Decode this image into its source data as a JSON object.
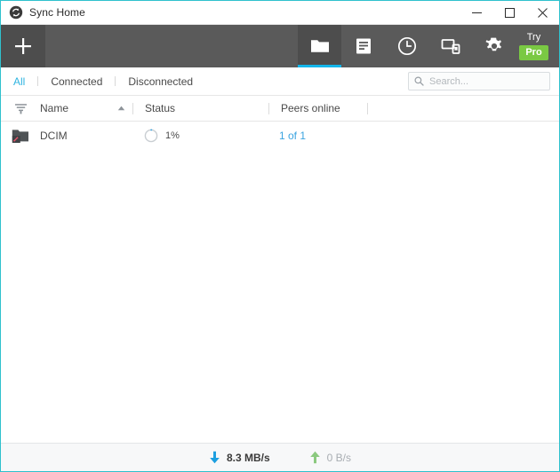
{
  "window": {
    "title": "Sync Home",
    "app_icon": "sync-circle-icon",
    "accent_border": "#2fc1cd",
    "controls": {
      "minimize": "minimize-icon",
      "maximize": "maximize-icon",
      "close": "close-icon"
    }
  },
  "toolbar": {
    "background": "#5a5a5a",
    "add_label": "+",
    "add_icon": "plus-icon",
    "active_underline": "#13b5ea",
    "tabs": [
      {
        "name": "folders",
        "icon": "folder-icon",
        "active": true
      },
      {
        "name": "transfers",
        "icon": "document-list-icon",
        "active": false
      },
      {
        "name": "history",
        "icon": "clock-icon",
        "active": false
      },
      {
        "name": "devices",
        "icon": "devices-icon",
        "active": false
      },
      {
        "name": "settings",
        "icon": "gear-icon",
        "active": false
      }
    ],
    "try_pro": {
      "try_label": "Try",
      "pro_label": "Pro",
      "badge_color": "#7ac943"
    }
  },
  "filters": {
    "items": [
      {
        "label": "All",
        "active": true
      },
      {
        "label": "Connected",
        "active": false
      },
      {
        "label": "Disconnected",
        "active": false
      }
    ],
    "active_color": "#2fb4e0"
  },
  "search": {
    "placeholder": "Search...",
    "value": "",
    "icon": "search-icon"
  },
  "table": {
    "filter_icon": "filter-icon",
    "columns": [
      {
        "key": "name",
        "label": "Name",
        "sort": "asc"
      },
      {
        "key": "status",
        "label": "Status"
      },
      {
        "key": "peers",
        "label": "Peers online"
      }
    ],
    "rows": [
      {
        "icon": "folder-sync-icon",
        "name": "DCIM",
        "status_percent": "1%",
        "progress": 1,
        "peers": "1 of 1"
      }
    ]
  },
  "statusbar": {
    "download": {
      "icon": "arrow-down-icon",
      "value": "8.3 MB/s",
      "color": "#1c9fe0"
    },
    "upload": {
      "icon": "arrow-up-icon",
      "value": "0 B/s",
      "color": "#8bc97f"
    }
  }
}
